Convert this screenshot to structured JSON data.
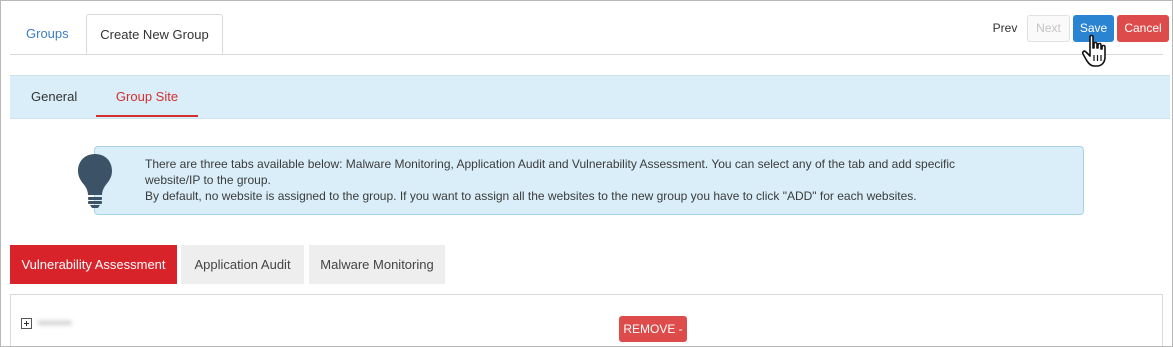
{
  "top_tabs": {
    "groups": "Groups",
    "create_new_group": "Create New Group"
  },
  "actions": {
    "prev": "Prev",
    "next": "Next",
    "save": "Save",
    "cancel": "Cancel"
  },
  "sub_tabs": {
    "general": "General",
    "group_site": "Group Site"
  },
  "info": {
    "icon": "lightbulb-icon",
    "line1": "There are three tabs available below: Malware Monitoring, Application Audit and Vulnerability Assessment. You can select any of the tab and add specific",
    "line2": "website/IP to the group.",
    "line3": "By default, no website is assigned to the group. If you want to assign all the websites to the new group you have to click \"ADD\" for each websites."
  },
  "asset_tabs": {
    "vulnerability": "Vulnerability Assessment",
    "application": "Application Audit",
    "malware": "Malware Monitoring"
  },
  "site_list": {
    "row": {
      "name": "••••••••",
      "remove": "REMOVE -"
    }
  },
  "colors": {
    "primary": "#2a84d1",
    "danger": "#dd4b4b",
    "active_tab": "#d9232b",
    "info_bg": "#d9eef8",
    "link": "#3b7fc4"
  }
}
